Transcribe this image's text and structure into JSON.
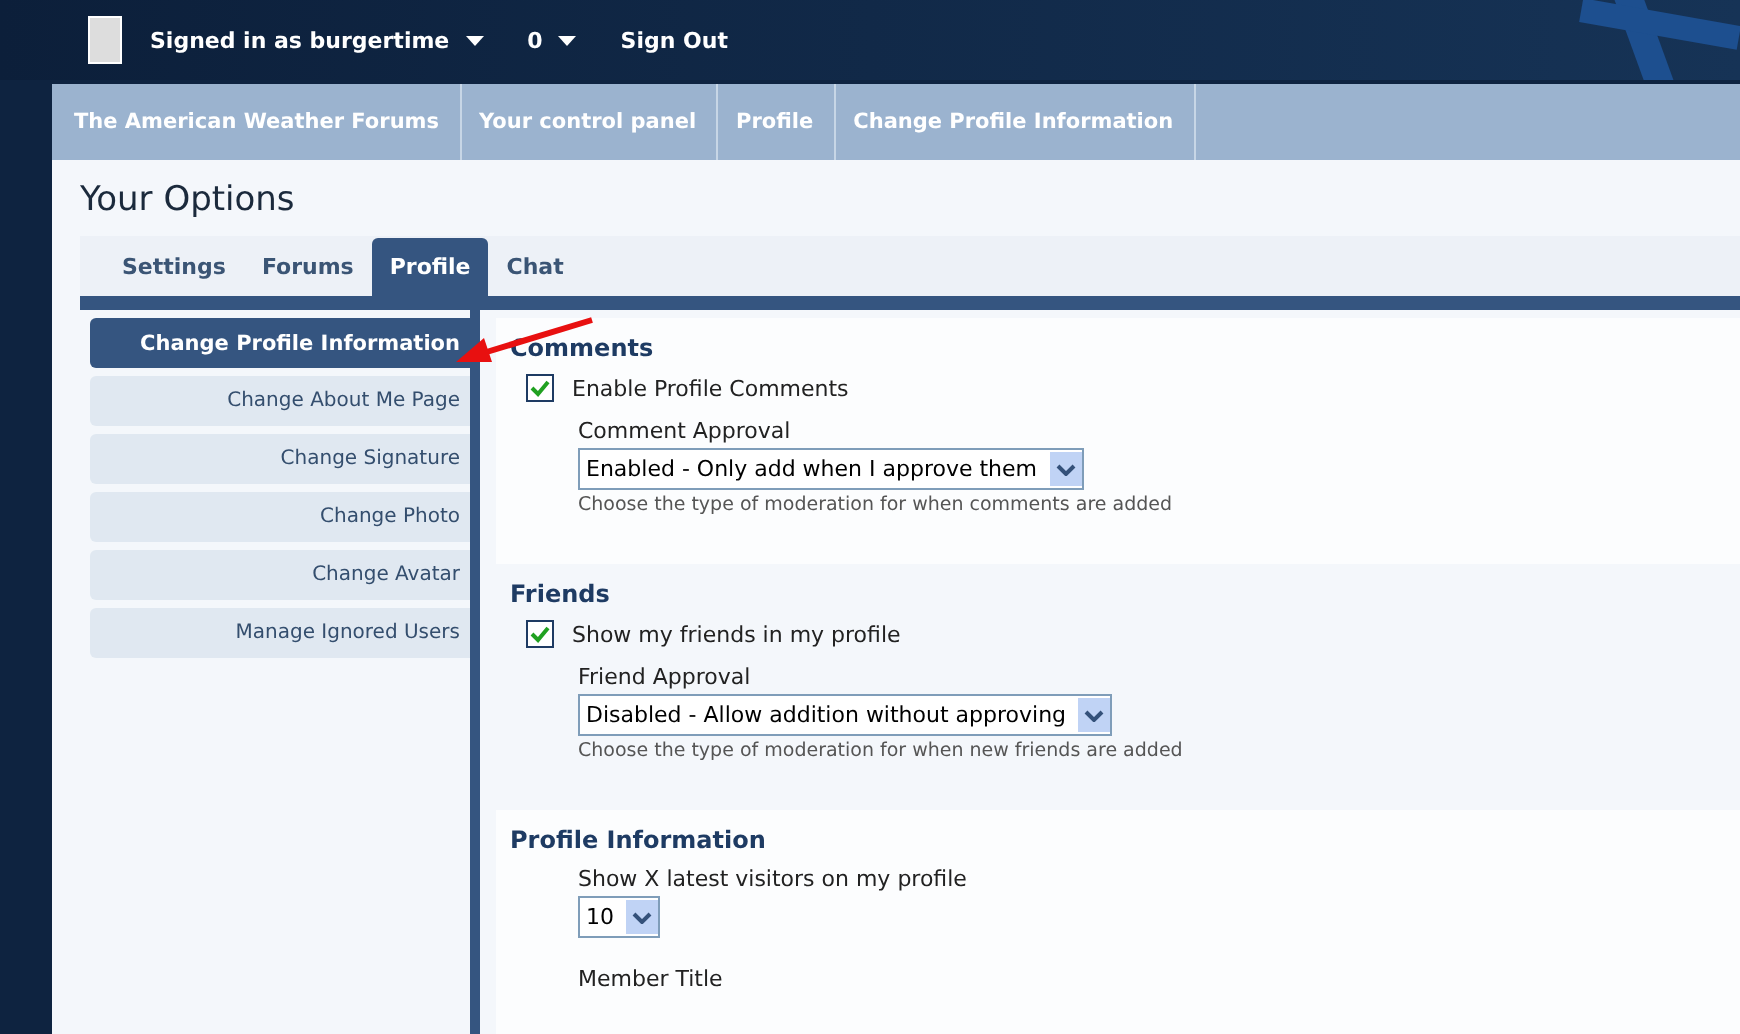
{
  "top_bar": {
    "user": "Signed in as burgertime",
    "count": "0",
    "sign_out": "Sign Out"
  },
  "breadcrumb": [
    "The American Weather Forums",
    "Your control panel",
    "Profile",
    "Change Profile Information"
  ],
  "title": "Your Options",
  "tabs": [
    {
      "label": "Settings",
      "selected": false
    },
    {
      "label": "Forums",
      "selected": false
    },
    {
      "label": "Profile",
      "selected": true
    },
    {
      "label": "Chat",
      "selected": false
    }
  ],
  "sidebar": {
    "items": [
      {
        "label": "Change Profile Information",
        "selected": true
      },
      {
        "label": "Change About Me Page",
        "selected": false
      },
      {
        "label": "Change Signature",
        "selected": false
      },
      {
        "label": "Change Photo",
        "selected": false
      },
      {
        "label": "Change Avatar",
        "selected": false
      },
      {
        "label": "Manage Ignored Users",
        "selected": false
      }
    ]
  },
  "sections": [
    {
      "heading": "Comments",
      "checkbox": {
        "label": "Enable Profile Comments",
        "checked": true
      },
      "fields": [
        {
          "label": "Comment Approval",
          "value": "Enabled - Only add when I approve them",
          "hint": "Choose the type of moderation for when comments are added"
        }
      ]
    },
    {
      "heading": "Friends",
      "checkbox": {
        "label": "Show my friends in my profile",
        "checked": true
      },
      "fields": [
        {
          "label": "Friend Approval",
          "value": "Disabled - Allow addition without approving",
          "hint": "Choose the type of moderation for when new friends are added"
        }
      ]
    },
    {
      "heading": "Profile Information",
      "fields": [
        {
          "label": "Show X latest visitors on my profile",
          "value": "10"
        },
        {
          "label": "Member Title"
        }
      ]
    }
  ]
}
